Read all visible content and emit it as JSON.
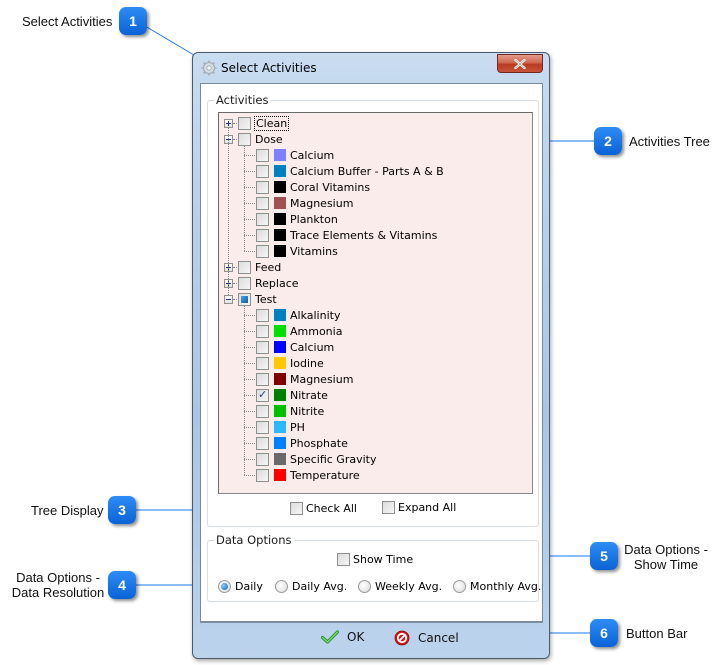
{
  "callouts": [
    {
      "number": "1",
      "label": "Select Activities"
    },
    {
      "number": "2",
      "label": "Activities Tree"
    },
    {
      "number": "3",
      "label": "Tree Display"
    },
    {
      "number": "4",
      "label_line1": "Data Options -",
      "label_line2": "Data Resolution"
    },
    {
      "number": "5",
      "label_line1": "Data Options -",
      "label_line2": "Show Time"
    },
    {
      "number": "6",
      "label": "Button Bar"
    }
  ],
  "colors": {
    "callout_badge": "#1a78ec",
    "leader_line": "#1a78ec",
    "tree_background": "#faecea"
  },
  "window": {
    "title": "Select Activities",
    "title_icon": "gear-icon",
    "close_icon": "close-icon"
  },
  "activities": {
    "group_title": "Activities",
    "tree": [
      {
        "label": "Clean",
        "expanded": false,
        "state": "unchecked",
        "focused": true
      },
      {
        "label": "Dose",
        "expanded": true,
        "state": "unchecked",
        "children": [
          {
            "label": "Calcium",
            "color": "#8080ff",
            "checked": false
          },
          {
            "label": "Calcium Buffer - Parts A & B",
            "color": "#0080c0",
            "checked": false
          },
          {
            "label": "Coral Vitamins",
            "color": "#000000",
            "checked": false
          },
          {
            "label": "Magnesium",
            "color": "#a05050",
            "checked": false
          },
          {
            "label": "Plankton",
            "color": "#000000",
            "checked": false
          },
          {
            "label": "Trace Elements & Vitamins",
            "color": "#000000",
            "checked": false
          },
          {
            "label": "Vitamins",
            "color": "#000000",
            "checked": false
          }
        ]
      },
      {
        "label": "Feed",
        "expanded": false,
        "state": "unchecked"
      },
      {
        "label": "Replace",
        "expanded": false,
        "state": "unchecked"
      },
      {
        "label": "Test",
        "expanded": true,
        "state": "indeterminate",
        "children": [
          {
            "label": "Alkalinity",
            "color": "#0080c0",
            "checked": false
          },
          {
            "label": "Ammonia",
            "color": "#00e000",
            "checked": false
          },
          {
            "label": "Calcium",
            "color": "#0000ff",
            "checked": false
          },
          {
            "label": "Iodine",
            "color": "#ffc800",
            "checked": false
          },
          {
            "label": "Magnesium",
            "color": "#800000",
            "checked": false
          },
          {
            "label": "Nitrate",
            "color": "#008000",
            "checked": true
          },
          {
            "label": "Nitrite",
            "color": "#00c000",
            "checked": false
          },
          {
            "label": "PH",
            "color": "#30b8ff",
            "checked": false
          },
          {
            "label": "Phosphate",
            "color": "#0080ff",
            "checked": false
          },
          {
            "label": "Specific Gravity",
            "color": "#6a6a6a",
            "checked": false
          },
          {
            "label": "Temperature",
            "color": "#ff0000",
            "checked": false
          }
        ]
      }
    ],
    "check_all_label": "Check All",
    "check_all_checked": false,
    "expand_all_label": "Expand All",
    "expand_all_checked": false
  },
  "data_options": {
    "group_title": "Data Options",
    "show_time_label": "Show Time",
    "show_time_checked": false,
    "resolution_options": [
      "Daily",
      "Daily Avg.",
      "Weekly Avg.",
      "Monthly Avg."
    ],
    "resolution_selected": "Daily"
  },
  "buttons": {
    "ok_label": "OK",
    "ok_icon": "checkmark-icon",
    "cancel_label": "Cancel",
    "cancel_icon": "no-entry-icon"
  }
}
